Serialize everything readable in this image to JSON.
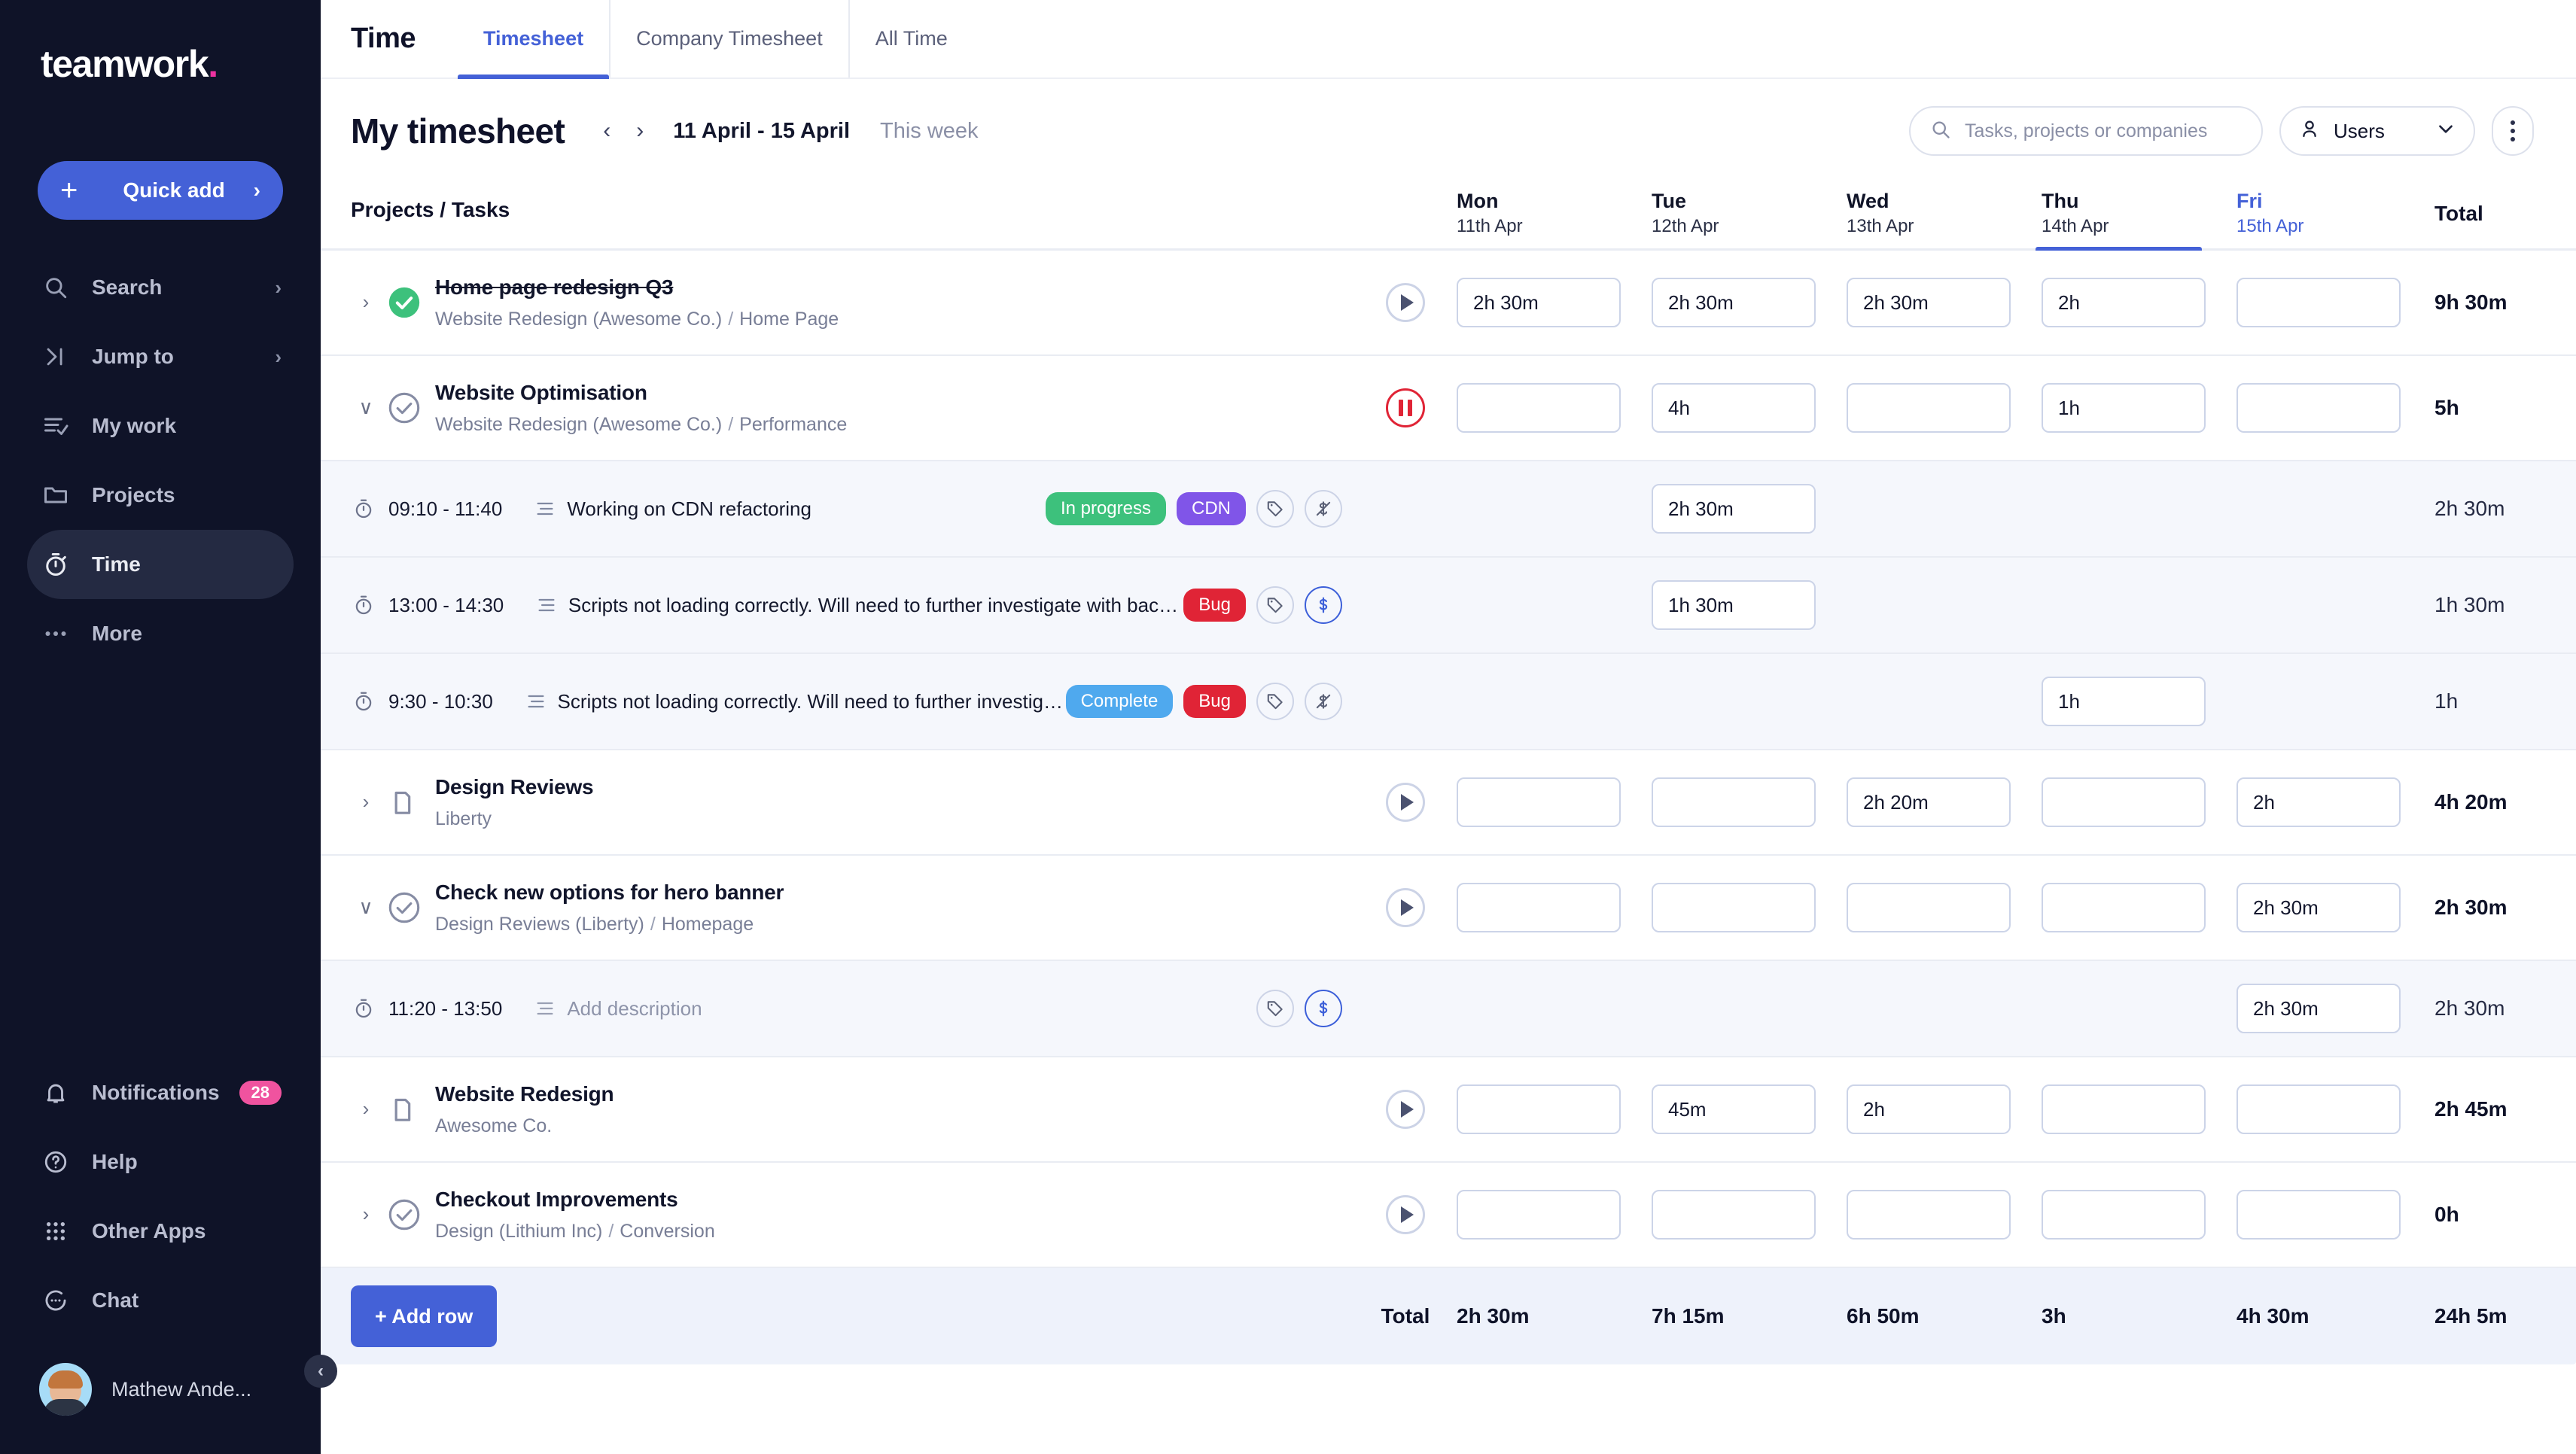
{
  "brand": {
    "name": "teamwork",
    "accent": "#ed32a0",
    "primary": "#4461d7"
  },
  "sidebar": {
    "quick_add": {
      "label": "Quick add",
      "plus": "+",
      "chevron": "›"
    },
    "items": [
      {
        "label": "Search",
        "icon": "search-icon",
        "chevron": "›",
        "active": false
      },
      {
        "label": "Jump to",
        "icon": "jump-to-icon",
        "chevron": "›",
        "active": false
      },
      {
        "label": "My work",
        "icon": "my-work-icon",
        "chevron": "",
        "active": false
      },
      {
        "label": "Projects",
        "icon": "folder-icon",
        "chevron": "",
        "active": false
      },
      {
        "label": "Time",
        "icon": "stopwatch-icon",
        "chevron": "",
        "active": true
      },
      {
        "label": "More",
        "icon": "ellipsis-icon",
        "chevron": "",
        "active": false
      }
    ],
    "bottom_items": [
      {
        "label": "Notifications",
        "icon": "bell-icon",
        "badge": "28"
      },
      {
        "label": "Help",
        "icon": "question-circle-icon",
        "badge": ""
      },
      {
        "label": "Other Apps",
        "icon": "grid-dots-icon",
        "badge": ""
      },
      {
        "label": "Chat",
        "icon": "chat-icon",
        "badge": ""
      }
    ],
    "user": {
      "name": "Mathew Ande...",
      "avatar": "user-avatar"
    },
    "collapse": "‹"
  },
  "topbar": {
    "title": "Time",
    "tabs": [
      {
        "label": "Timesheet",
        "active": true
      },
      {
        "label": "Company Timesheet",
        "active": false
      },
      {
        "label": "All Time",
        "active": false
      }
    ]
  },
  "pageheader": {
    "title": "My timesheet",
    "prev": "‹",
    "next": "›",
    "date_range": "11 April - 15 April",
    "this_week": "This week"
  },
  "search": {
    "placeholder": "Tasks, projects or companies",
    "value": ""
  },
  "users_select": {
    "label": "Users",
    "chevron": "∨"
  },
  "table": {
    "name_header": "Projects / Tasks",
    "total_header": "Total",
    "days": [
      {
        "name": "Mon",
        "date": "11th Apr",
        "today": false,
        "current": false
      },
      {
        "name": "Tue",
        "date": "12th Apr",
        "today": false,
        "current": false
      },
      {
        "name": "Wed",
        "date": "13th Apr",
        "today": false,
        "current": false
      },
      {
        "name": "Thu",
        "date": "14th Apr",
        "today": false,
        "current": true
      },
      {
        "name": "Fri",
        "date": "15th Apr",
        "today": true,
        "current": false
      }
    ],
    "rows": [
      {
        "kind": "task",
        "twisty": "›",
        "status_icon": "check-circle-filled-icon",
        "title": "Home page redesign Q3",
        "strikethrough": true,
        "project": "Website Redesign (Awesome Co.)",
        "breadcrumb": "Home Page",
        "timer": "play",
        "values": [
          "2h 30m",
          "2h 30m",
          "2h 30m",
          "2h",
          ""
        ],
        "total": "9h 30m"
      },
      {
        "kind": "task",
        "twisty": "∨",
        "status_icon": "check-circle-icon",
        "title": "Website Optimisation",
        "strikethrough": false,
        "project": "Website Redesign (Awesome Co.)",
        "breadcrumb": "Performance",
        "timer": "pause",
        "values": [
          "",
          "4h",
          "",
          "1h",
          ""
        ],
        "total": "5h"
      },
      {
        "kind": "entry",
        "hours": "09:10 - 11:40",
        "description": "Working on CDN refactoring",
        "placeholder": false,
        "tags": [
          {
            "label": "In progress",
            "color": "#3dc17c"
          },
          {
            "label": "CDN",
            "color": "#8055e8"
          }
        ],
        "billable": false,
        "values": [
          "",
          "2h 30m",
          "",
          "",
          ""
        ],
        "total": "2h 30m"
      },
      {
        "kind": "entry",
        "hours": "13:00 - 14:30",
        "description": "Scripts not loading correctly. Will need to further investigate with back-...",
        "placeholder": false,
        "tags": [
          {
            "label": "Bug",
            "color": "#e02436"
          }
        ],
        "billable": true,
        "values": [
          "",
          "1h 30m",
          "",
          "",
          ""
        ],
        "total": "1h 30m"
      },
      {
        "kind": "entry",
        "hours": "9:30 - 10:30",
        "description": "Scripts not loading correctly. Will need to further investiga...",
        "placeholder": false,
        "tags": [
          {
            "label": "Complete",
            "color": "#4fa9ee"
          },
          {
            "label": "Bug",
            "color": "#e02436"
          }
        ],
        "billable": false,
        "values": [
          "",
          "",
          "",
          "1h",
          ""
        ],
        "total": "1h"
      },
      {
        "kind": "task",
        "twisty": "›",
        "status_icon": "folder-icon",
        "title": "Design Reviews",
        "strikethrough": false,
        "project": "Liberty",
        "breadcrumb": "",
        "timer": "play",
        "values": [
          "",
          "",
          "2h 20m",
          "",
          "2h"
        ],
        "total": "4h 20m"
      },
      {
        "kind": "task",
        "twisty": "∨",
        "status_icon": "check-circle-icon",
        "title": "Check new options for hero banner",
        "strikethrough": false,
        "project": "Design Reviews (Liberty)",
        "breadcrumb": "Homepage",
        "timer": "play",
        "values": [
          "",
          "",
          "",
          "",
          "2h 30m"
        ],
        "total": "2h 30m"
      },
      {
        "kind": "entry",
        "hours": "11:20 - 13:50",
        "description": "Add description",
        "placeholder": true,
        "tags": [],
        "billable": true,
        "values": [
          "",
          "",
          "",
          "",
          "2h 30m"
        ],
        "total": "2h 30m"
      },
      {
        "kind": "task",
        "twisty": "›",
        "status_icon": "folder-icon",
        "title": "Website Redesign",
        "strikethrough": false,
        "project": "Awesome Co.",
        "breadcrumb": "",
        "timer": "play",
        "values": [
          "",
          "45m",
          "2h",
          "",
          ""
        ],
        "total": "2h 45m"
      },
      {
        "kind": "task",
        "twisty": "›",
        "status_icon": "check-circle-icon",
        "title": "Checkout Improvements",
        "strikethrough": false,
        "project": "Design (Lithium Inc)",
        "breadcrumb": "Conversion",
        "timer": "play",
        "values": [
          "",
          "",
          "",
          "",
          ""
        ],
        "total": "0h"
      }
    ],
    "footer": {
      "add_row": "+ Add row",
      "total_label": "Total",
      "day_totals": [
        "2h 30m",
        "7h 15m",
        "6h 50m",
        "3h",
        "4h 30m"
      ],
      "grand_total": "24h 5m"
    }
  }
}
